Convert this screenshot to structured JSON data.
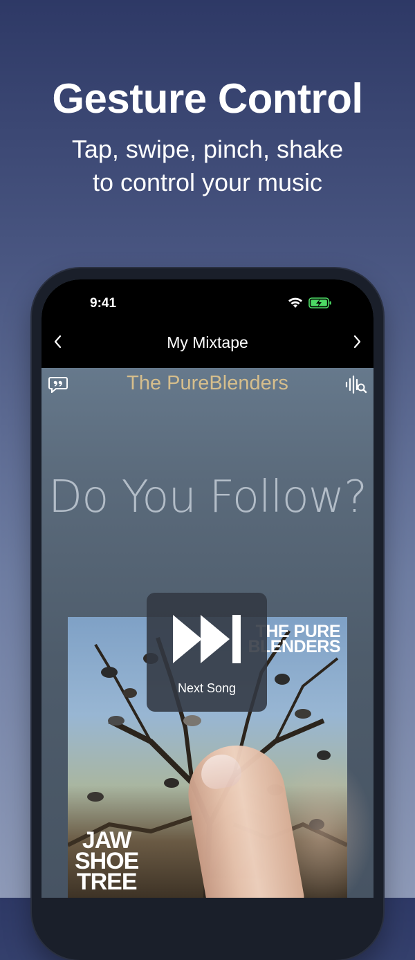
{
  "promo": {
    "title": "Gesture Control",
    "subtitle_line1": "Tap, swipe, pinch, shake",
    "subtitle_line2": "to control your music"
  },
  "status_bar": {
    "time": "9:41",
    "wifi_icon": "wifi-icon",
    "battery_icon": "battery-charging-icon"
  },
  "nav": {
    "title": "My Mixtape",
    "back_icon": "chevron-left-icon",
    "forward_icon": "chevron-right-icon"
  },
  "now_playing": {
    "artist": "The PureBlenders",
    "song_title": "Do You Follow?",
    "lyrics_icon": "lyrics-quote-icon",
    "shazam_icon": "audio-search-icon"
  },
  "album_art": {
    "band_line1": "THE PURE",
    "band_line2": "BLENDERS",
    "album_line1": "JAW",
    "album_line2": "SHOE",
    "album_line3": "TREE"
  },
  "gesture_hud": {
    "icon": "next-track-icon",
    "label": "Next Song"
  },
  "colors": {
    "artist_text": "#d6be8c",
    "battery_fill": "#4cd964",
    "background_top": "#2e3966",
    "background_bottom": "#8e9ab8"
  }
}
